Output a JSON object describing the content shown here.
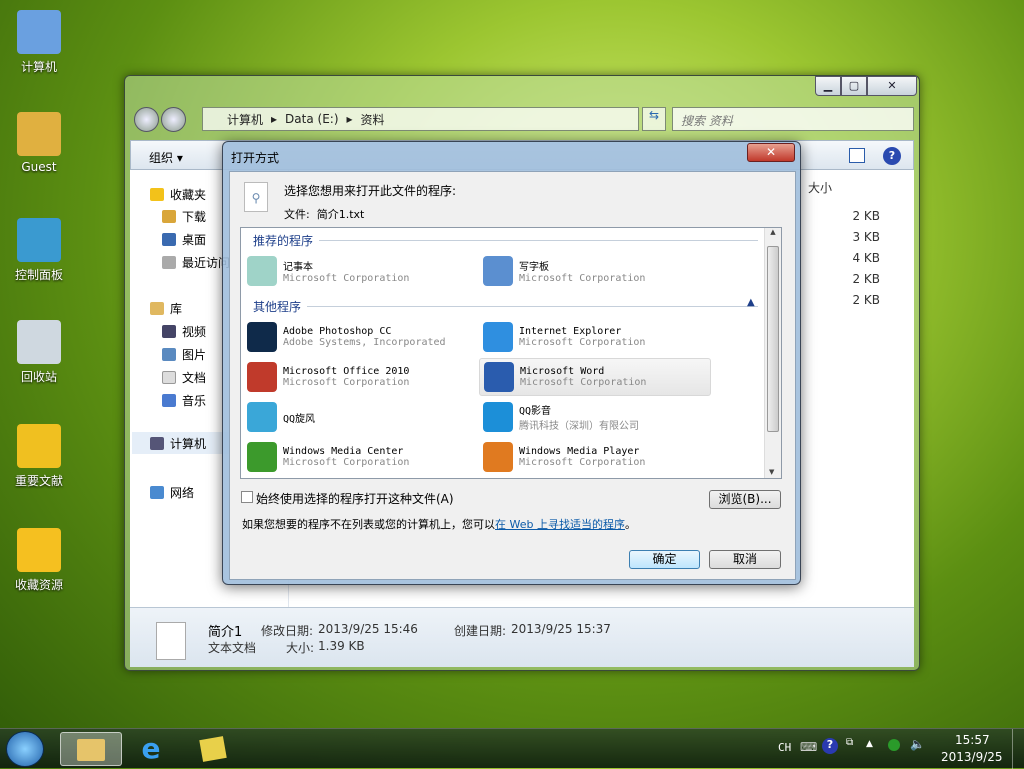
{
  "desktop": {
    "icons": [
      {
        "label": "计算机",
        "icon": "computer-icon"
      },
      {
        "label": "Guest",
        "icon": "user-folder-icon"
      },
      {
        "label": "控制面板",
        "icon": "control-panel-icon"
      },
      {
        "label": "回收站",
        "icon": "recycle-bin-icon"
      },
      {
        "label": "重要文献",
        "icon": "warning-icon"
      },
      {
        "label": "收藏资源",
        "icon": "star-shortcut-icon"
      }
    ]
  },
  "explorer": {
    "breadcrumb": [
      "计算机",
      "Data (E:)",
      "资料"
    ],
    "search_placeholder": "搜索 资料",
    "toolbar": {
      "organize": "组织 ▾"
    },
    "nav": {
      "favorites": "收藏夹",
      "downloads": "下载",
      "desktop": "桌面",
      "recent": "最近访问",
      "libraries": "库",
      "videos": "视频",
      "pictures": "图片",
      "documents": "文档",
      "music": "音乐",
      "computer": "计算机",
      "network": "网络"
    },
    "column_size": "大小",
    "sizes": [
      "2 KB",
      "3 KB",
      "4 KB",
      "2 KB",
      "2 KB"
    ],
    "details": {
      "name": "简介1",
      "type": "文本文档",
      "modified_label": "修改日期:",
      "modified": "2013/9/25 15:46",
      "created_label": "创建日期:",
      "created": "2013/9/25 15:37",
      "size_label": "大小:",
      "size": "1.39 KB"
    }
  },
  "dialog": {
    "title": "打开方式",
    "prompt": "选择您想用来打开此文件的程序:",
    "file_label": "文件:",
    "file_name": "简介1.txt",
    "recommended_label": "推荐的程序",
    "other_label": "其他程序",
    "recommended": [
      {
        "name": "记事本",
        "company": "Microsoft Corporation",
        "icon": "notepad-icon",
        "color": "#9fd3c8"
      },
      {
        "name": "写字板",
        "company": "Microsoft Corporation",
        "icon": "wordpad-icon",
        "color": "#5b8fd0"
      }
    ],
    "others": [
      {
        "name": "Adobe Photoshop CC",
        "company": "Adobe Systems, Incorporated",
        "icon": "photoshop-icon",
        "color": "#0f2a4a"
      },
      {
        "name": "Internet Explorer",
        "company": "Microsoft Corporation",
        "icon": "ie-icon",
        "color": "#2f8fe0"
      },
      {
        "name": "Microsoft Office 2010",
        "company": "Microsoft Corporation",
        "icon": "office-icon",
        "color": "#c03a2b"
      },
      {
        "name": "Microsoft Word",
        "company": "Microsoft Corporation",
        "icon": "word-icon",
        "color": "#2a5cae"
      },
      {
        "name": "QQ旋风",
        "company": "",
        "icon": "qq-xuanfeng-icon",
        "color": "#3aa7d8"
      },
      {
        "name": "QQ影音",
        "company": "腾讯科技（深圳）有限公司",
        "icon": "qq-player-icon",
        "color": "#1c8fd8"
      },
      {
        "name": "Windows Media Center",
        "company": "Microsoft Corporation",
        "icon": "media-center-icon",
        "color": "#3c9a2c"
      },
      {
        "name": "Windows Media Player",
        "company": "Microsoft Corporation",
        "icon": "media-player-icon",
        "color": "#e07a20"
      }
    ],
    "always_use": "始终使用选择的程序打开这种文件(A)",
    "browse": "浏览(B)...",
    "hint": "如果您想要的程序不在列表或您的计算机上，您可以",
    "hint_link": "在 Web 上寻找适当的程序",
    "hint_end": "。",
    "ok": "确定",
    "cancel": "取消"
  },
  "taskbar": {
    "lang": "CH",
    "time": "15:57",
    "date": "2013/9/25"
  }
}
